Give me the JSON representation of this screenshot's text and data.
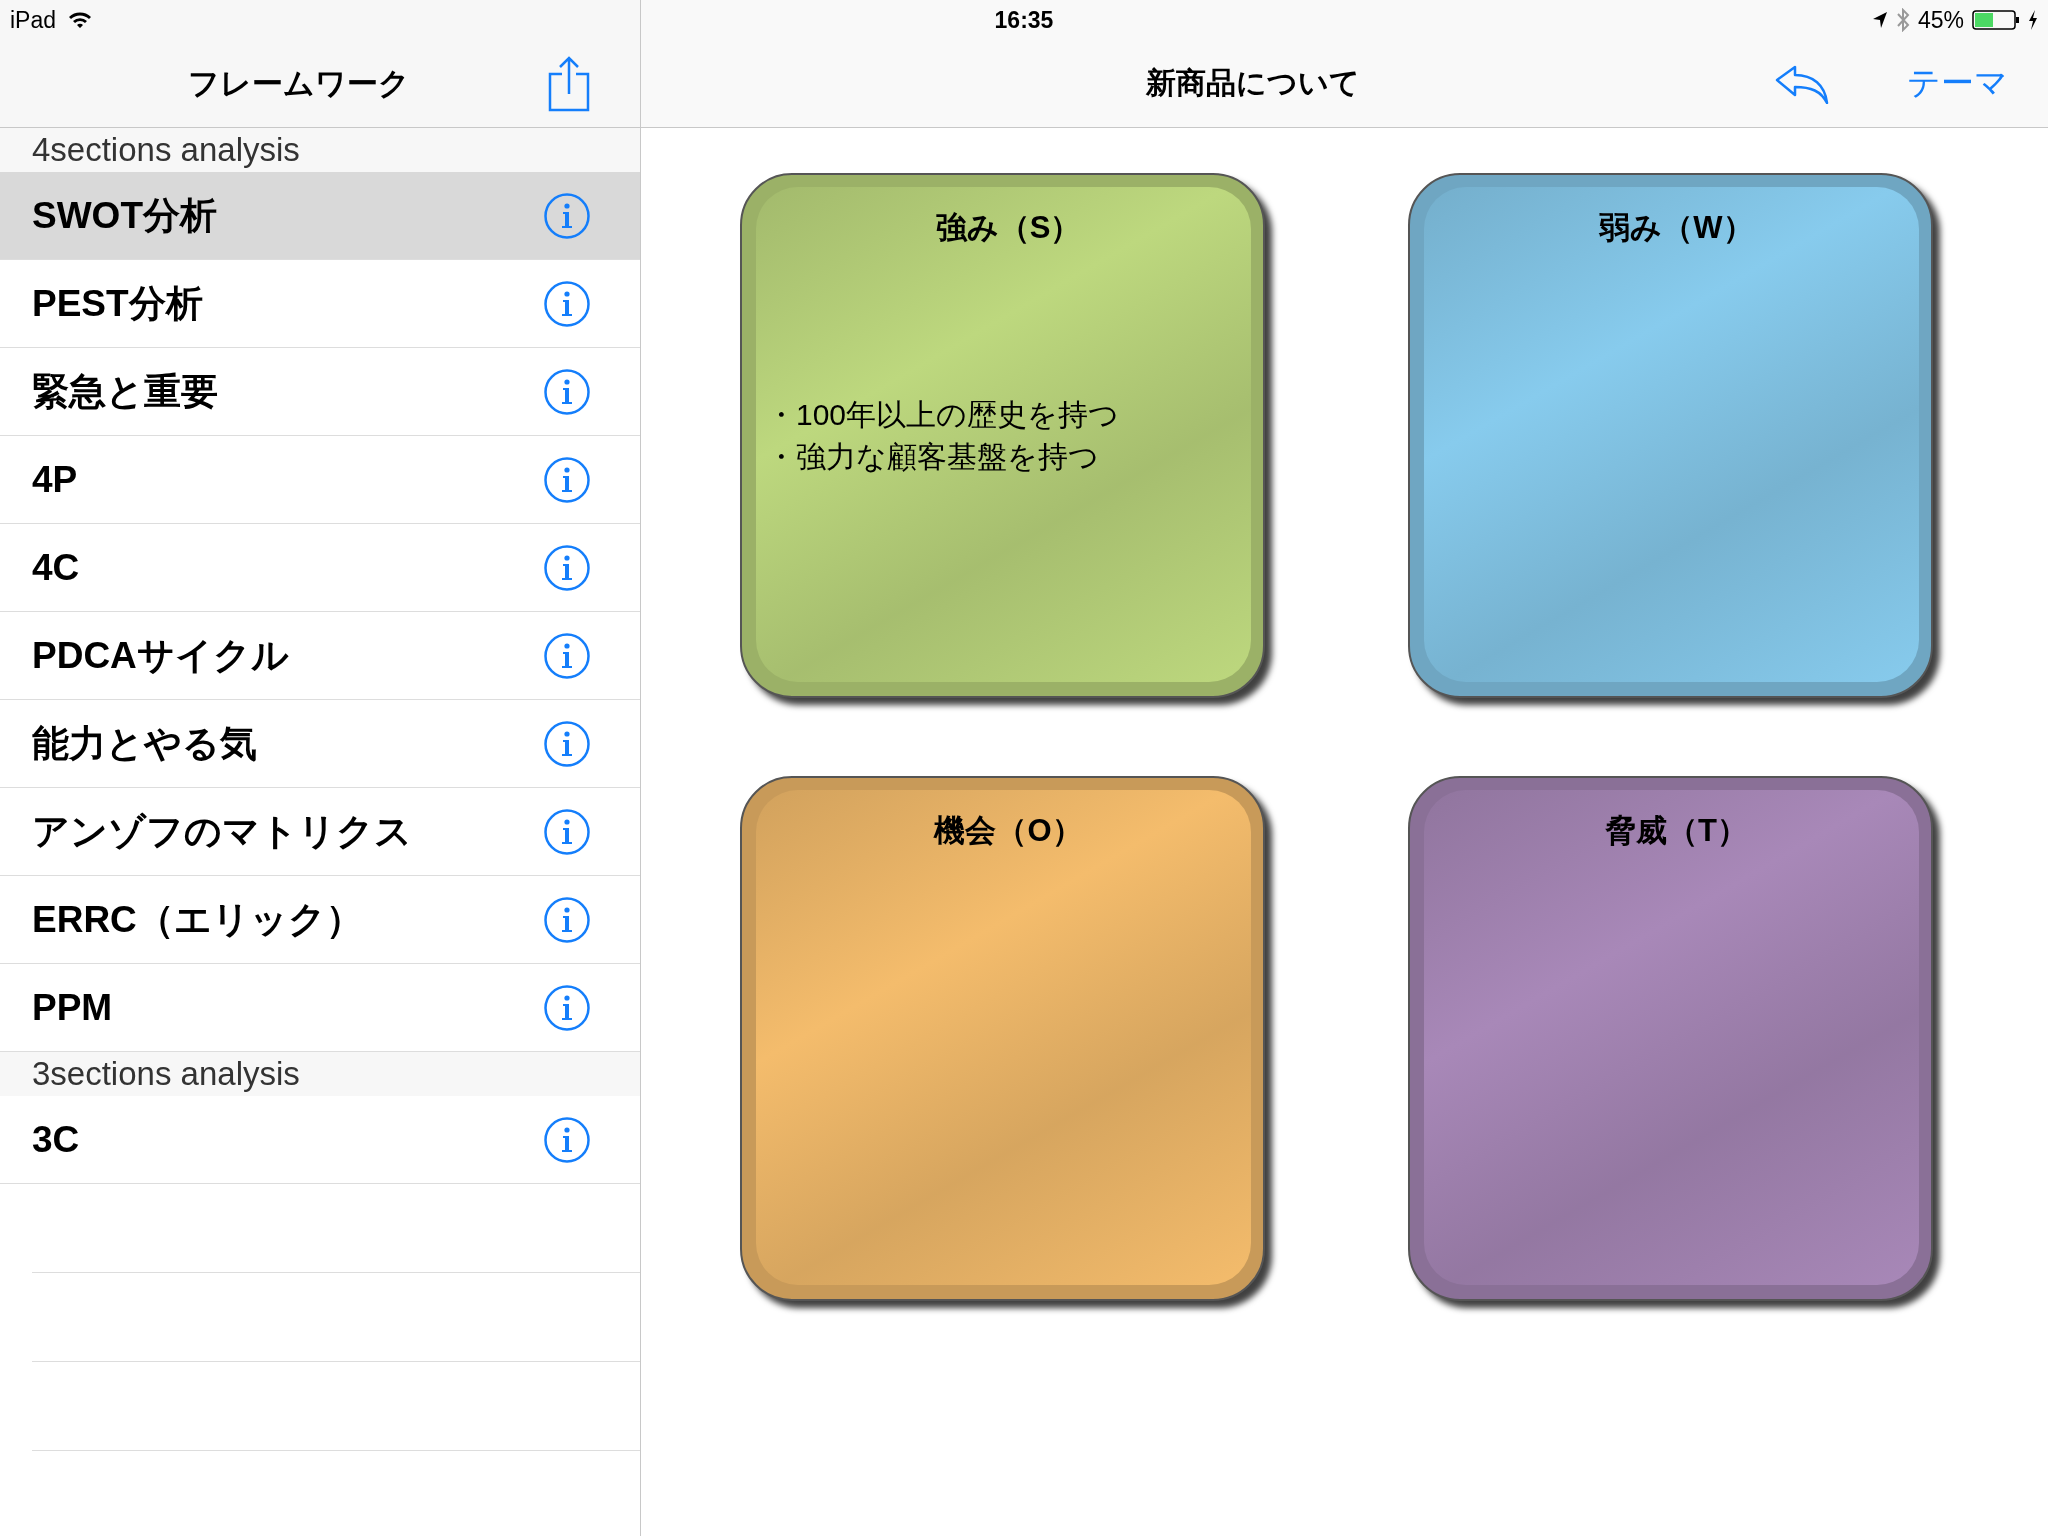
{
  "status_bar": {
    "device": "iPad",
    "time": "16:35",
    "battery": "45%"
  },
  "sidebar": {
    "title": "フレームワーク",
    "sections": [
      {
        "header": "4sections analysis",
        "items": [
          {
            "label": "SWOT分析",
            "selected": true
          },
          {
            "label": "PEST分析",
            "selected": false
          },
          {
            "label": "緊急と重要",
            "selected": false
          },
          {
            "label": "4P",
            "selected": false
          },
          {
            "label": "4C",
            "selected": false
          },
          {
            "label": "PDCAサイクル",
            "selected": false
          },
          {
            "label": "能力とやる気",
            "selected": false
          },
          {
            "label": "アンゾフのマトリクス",
            "selected": false
          },
          {
            "label": "ERRC（エリック）",
            "selected": false
          },
          {
            "label": "PPM",
            "selected": false
          }
        ]
      },
      {
        "header": "3sections analysis",
        "items": [
          {
            "label": "3C",
            "selected": false
          }
        ]
      }
    ]
  },
  "main": {
    "title": "新商品について",
    "theme_button": "テーマ",
    "cards": [
      {
        "title": "強み（S）",
        "color": "#bdd87e",
        "lines": [
          "・100年以上の歴史を持つ",
          "・強力な顧客基盤を持つ"
        ]
      },
      {
        "title": "弱み（W）",
        "color": "#87cbed"
      },
      {
        "title": "機会（O）",
        "color": "#f4bc6c"
      },
      {
        "title": "脅威（T）",
        "color": "#a888b8"
      }
    ]
  }
}
